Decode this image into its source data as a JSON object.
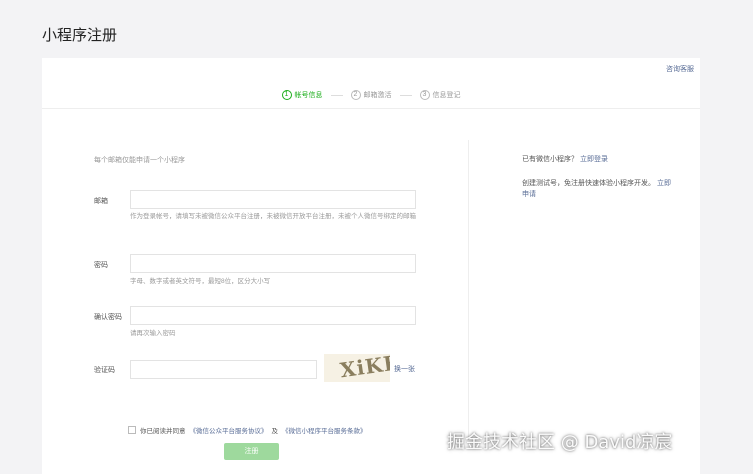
{
  "page": {
    "title": "小程序注册",
    "help_link": "咨询客服"
  },
  "steps": [
    {
      "num": "1",
      "label": "帐号信息",
      "active": true
    },
    {
      "num": "2",
      "label": "邮箱激活",
      "active": false
    },
    {
      "num": "3",
      "label": "信息登记",
      "active": false
    }
  ],
  "form": {
    "hint": "每个邮箱仅能申请一个小程序",
    "email": {
      "label": "邮箱",
      "value": "",
      "tip": "作为登录帐号，请填写未被微信公众平台注册，未被微信开放平台注册，未被个人微信号绑定的邮箱"
    },
    "password": {
      "label": "密码",
      "value": "",
      "tip": "字母、数字或者英文符号，最短8位，区分大小写"
    },
    "confirm_password": {
      "label": "确认密码",
      "value": "",
      "tip": "请再次输入密码"
    },
    "captcha": {
      "label": "验证码",
      "value": "",
      "image_text": "XiKH",
      "refresh_label": "换一张"
    },
    "agreement": {
      "prefix": "你已阅读并同意",
      "link1": "《微信公众平台服务协议》",
      "middle": "及",
      "link2": "《微信小程序平台服务条款》"
    },
    "submit_label": "注册"
  },
  "sidebar": {
    "login_prompt": "已有微信小程序？",
    "login_link": "立即登录",
    "test_prompt": "创建测试号，免注册快速体验小程序开发。",
    "test_link": "立即申请"
  },
  "watermark": "掘金技术社区 @ David凉宸",
  "colors": {
    "accent_green": "#1aad19",
    "button_disabled": "#9ed99d",
    "link_blue": "#576b95",
    "background": "#f3f3f5"
  }
}
